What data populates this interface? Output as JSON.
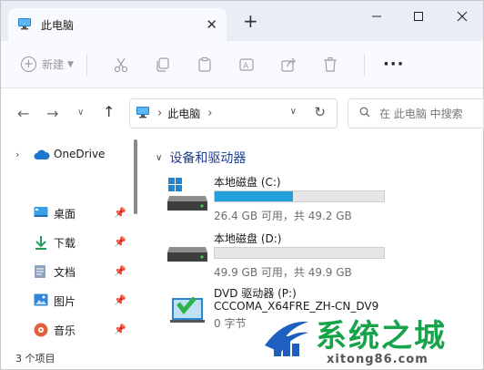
{
  "window": {
    "tab_title": "此电脑",
    "new_tab_symbol": "+",
    "close_tab_symbol": "✕"
  },
  "toolbar": {
    "new_label": "新建",
    "more_symbol": "···"
  },
  "address": {
    "path": "此电脑",
    "search_placeholder": "在 此电脑 中搜索"
  },
  "sidebar": {
    "items": [
      {
        "label": "OneDrive"
      },
      {
        "label": "桌面"
      },
      {
        "label": "下载"
      },
      {
        "label": "文档"
      },
      {
        "label": "图片"
      },
      {
        "label": "音乐"
      }
    ]
  },
  "content": {
    "group_title": "设备和驱动器",
    "drives": [
      {
        "name": "本地磁盘 (C:)",
        "info": "26.4 GB 可用，共 49.2 GB",
        "used_fraction": 0.46,
        "bar_color": "#26a0da"
      },
      {
        "name": "本地磁盘 (D:)",
        "info": "49.9 GB 可用，共 49.9 GB",
        "used_fraction": 0.0,
        "bar_color": "#26a0da"
      },
      {
        "name": "DVD 驱动器 (P:)",
        "label": "CCCOMA_X64FRE_ZH-CN_DV9",
        "info": "0 字节"
      }
    ]
  },
  "status": {
    "item_count": "3 个项目"
  },
  "watermark": {
    "title": "系统之城",
    "site": "xitong86.com"
  }
}
